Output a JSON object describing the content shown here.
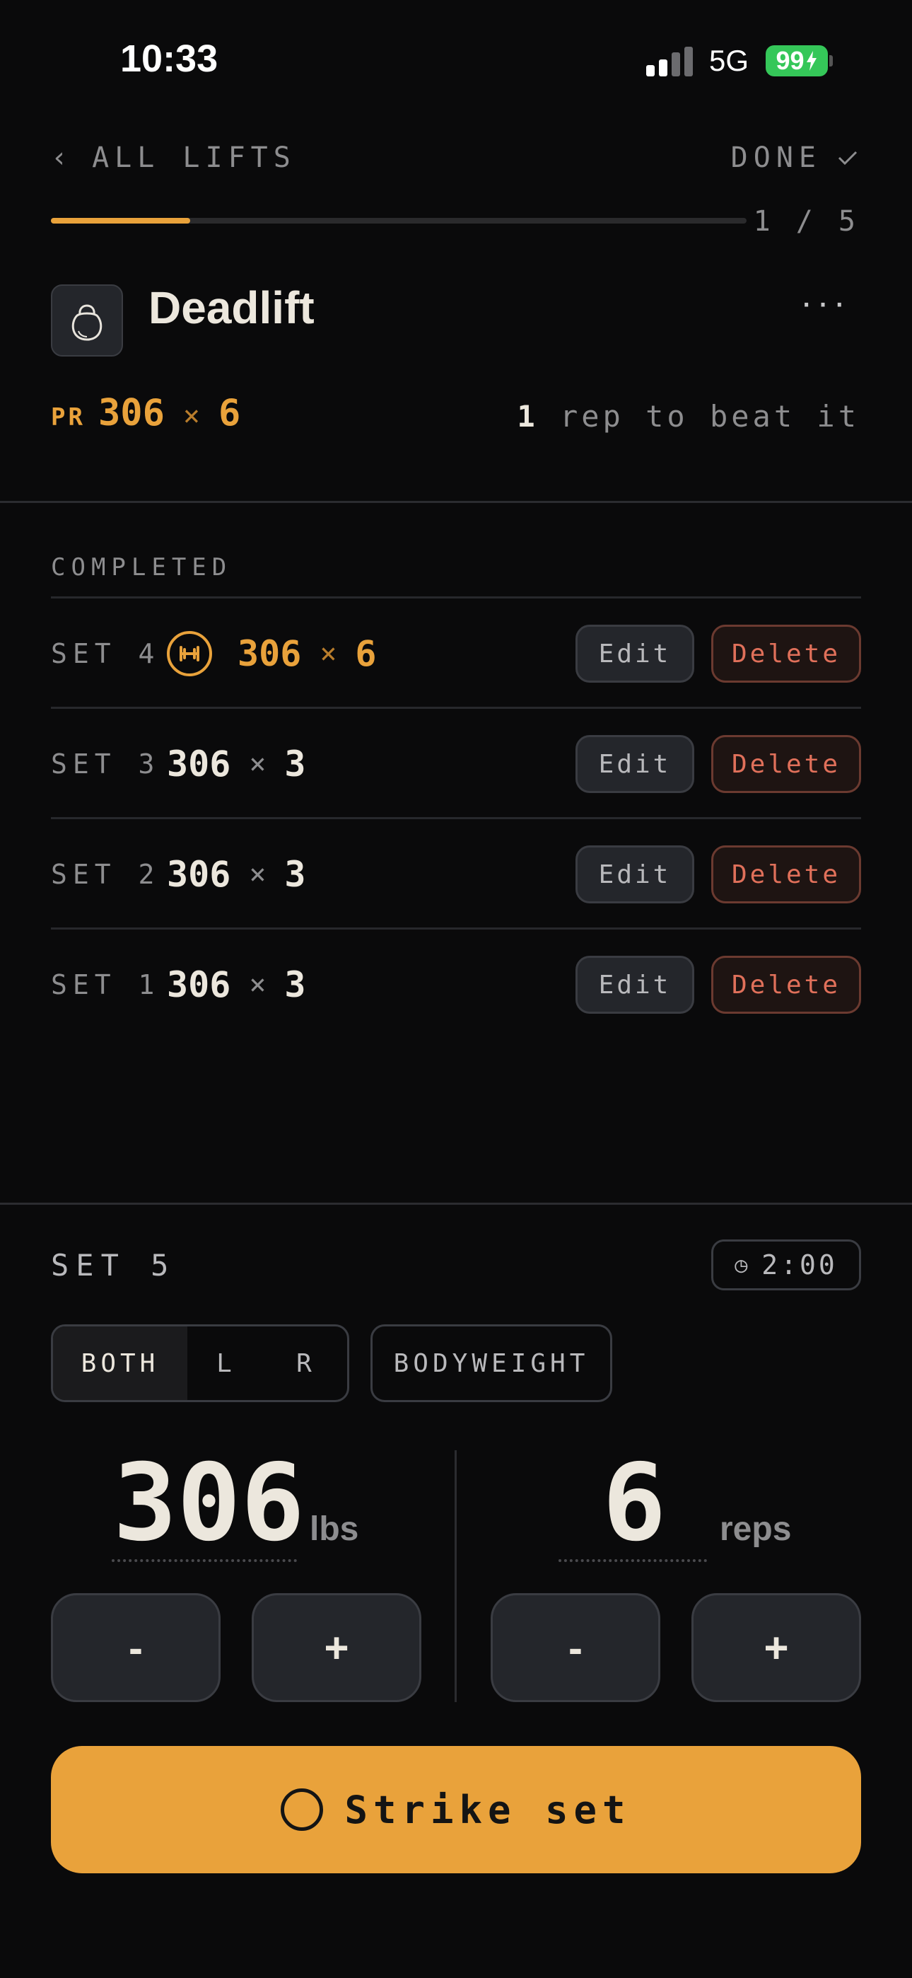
{
  "status_bar": {
    "time": "10:33",
    "network": "5G",
    "battery": "99"
  },
  "nav": {
    "back_label": "ALL LIFTS",
    "done_label": "DONE",
    "progress_count": "1 / 5",
    "progress_fraction": 0.2
  },
  "exercise": {
    "name": "Deadlift",
    "icon": "kettlebell-icon",
    "more": "···"
  },
  "pr": {
    "label": "PR",
    "weight": "306",
    "x": "×",
    "reps": "6"
  },
  "beat": {
    "count": "1",
    "text": "rep to beat it"
  },
  "completed": {
    "label": "COMPLETED",
    "sets": [
      {
        "label": "SET 4",
        "weight": "306",
        "x": "×",
        "reps": "6",
        "is_pr": true,
        "edit": "Edit",
        "delete": "Delete"
      },
      {
        "label": "SET 3",
        "weight": "306",
        "x": "×",
        "reps": "3",
        "is_pr": false,
        "edit": "Edit",
        "delete": "Delete"
      },
      {
        "label": "SET 2",
        "weight": "306",
        "x": "×",
        "reps": "3",
        "is_pr": false,
        "edit": "Edit",
        "delete": "Delete"
      },
      {
        "label": "SET 1",
        "weight": "306",
        "x": "×",
        "reps": "3",
        "is_pr": false,
        "edit": "Edit",
        "delete": "Delete"
      }
    ]
  },
  "current": {
    "label": "SET 5",
    "timer": "2:00",
    "sides": [
      "BOTH",
      "L",
      "R"
    ],
    "side_selected": "BOTH",
    "bodyweight": "BODYWEIGHT",
    "weight": "306",
    "weight_unit": "lbs",
    "reps": "6",
    "reps_unit": "reps",
    "minus": "-",
    "plus": "+",
    "strike_label": "Strike set"
  },
  "colors": {
    "accent": "#e9a23b",
    "danger": "#e0705a",
    "background": "#0a0a0b"
  }
}
